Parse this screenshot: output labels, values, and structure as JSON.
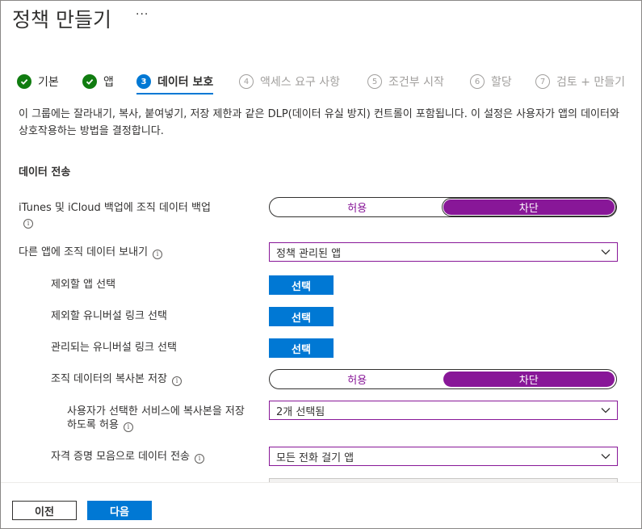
{
  "header": {
    "title": "정책 만들기",
    "more_label": "···"
  },
  "steps": [
    {
      "num": "",
      "label": "기본",
      "state": "done"
    },
    {
      "num": "",
      "label": "앱",
      "state": "done"
    },
    {
      "num": "3",
      "label": "데이터 보호",
      "state": "current"
    },
    {
      "num": "4",
      "label": "액세스 요구 사항",
      "state": "future"
    },
    {
      "num": "5",
      "label": "조건부 시작",
      "state": "future"
    },
    {
      "num": "6",
      "label": "할당",
      "state": "future"
    },
    {
      "num": "7",
      "label": "검토 + 만들기",
      "state": "future"
    }
  ],
  "description": "이 그룹에는 잘라내기, 복사, 붙여넣기, 저장 제한과 같은 DLP(데이터 유실 방지) 컨트롤이 포함됩니다. 이 설정은 사용자가 앱의 데이터와 상호작용하는 방법을 결정합니다.",
  "section_title": "데이터 전송",
  "info_glyph": "i",
  "colors": {
    "accent": "#0078d4",
    "toggle": "#881798",
    "done": "#107c10"
  },
  "fields": {
    "backup": {
      "label": "iTunes 및 iCloud 백업에 조직 데이터 백업",
      "opt_allow": "허용",
      "opt_block": "차단",
      "selected": "차단"
    },
    "send_data": {
      "label": "다른 앱에 조직 데이터 보내기",
      "value": "정책 관리된 앱"
    },
    "exempt_apps": {
      "label": "제외할 앱 선택",
      "button": "선택"
    },
    "exempt_universal": {
      "label": "제외할 유니버설 링크 선택",
      "button": "선택"
    },
    "managed_universal": {
      "label": "관리되는 유니버설 링크 선택",
      "button": "선택"
    },
    "save_copies": {
      "label": "조직 데이터의 복사본 저장",
      "opt_allow": "허용",
      "opt_block": "차단",
      "selected": "차단"
    },
    "save_services": {
      "label": "사용자가 선택한 서비스에 복사본을 저장하도록 허용",
      "value": "2개 선택됨"
    },
    "transfer_telecom": {
      "label": "자격 증명 모음으로 데이터 전송",
      "value": "모든 전화 걸기 앱"
    }
  },
  "footer": {
    "prev_label": "이전",
    "next_label": "다음"
  }
}
